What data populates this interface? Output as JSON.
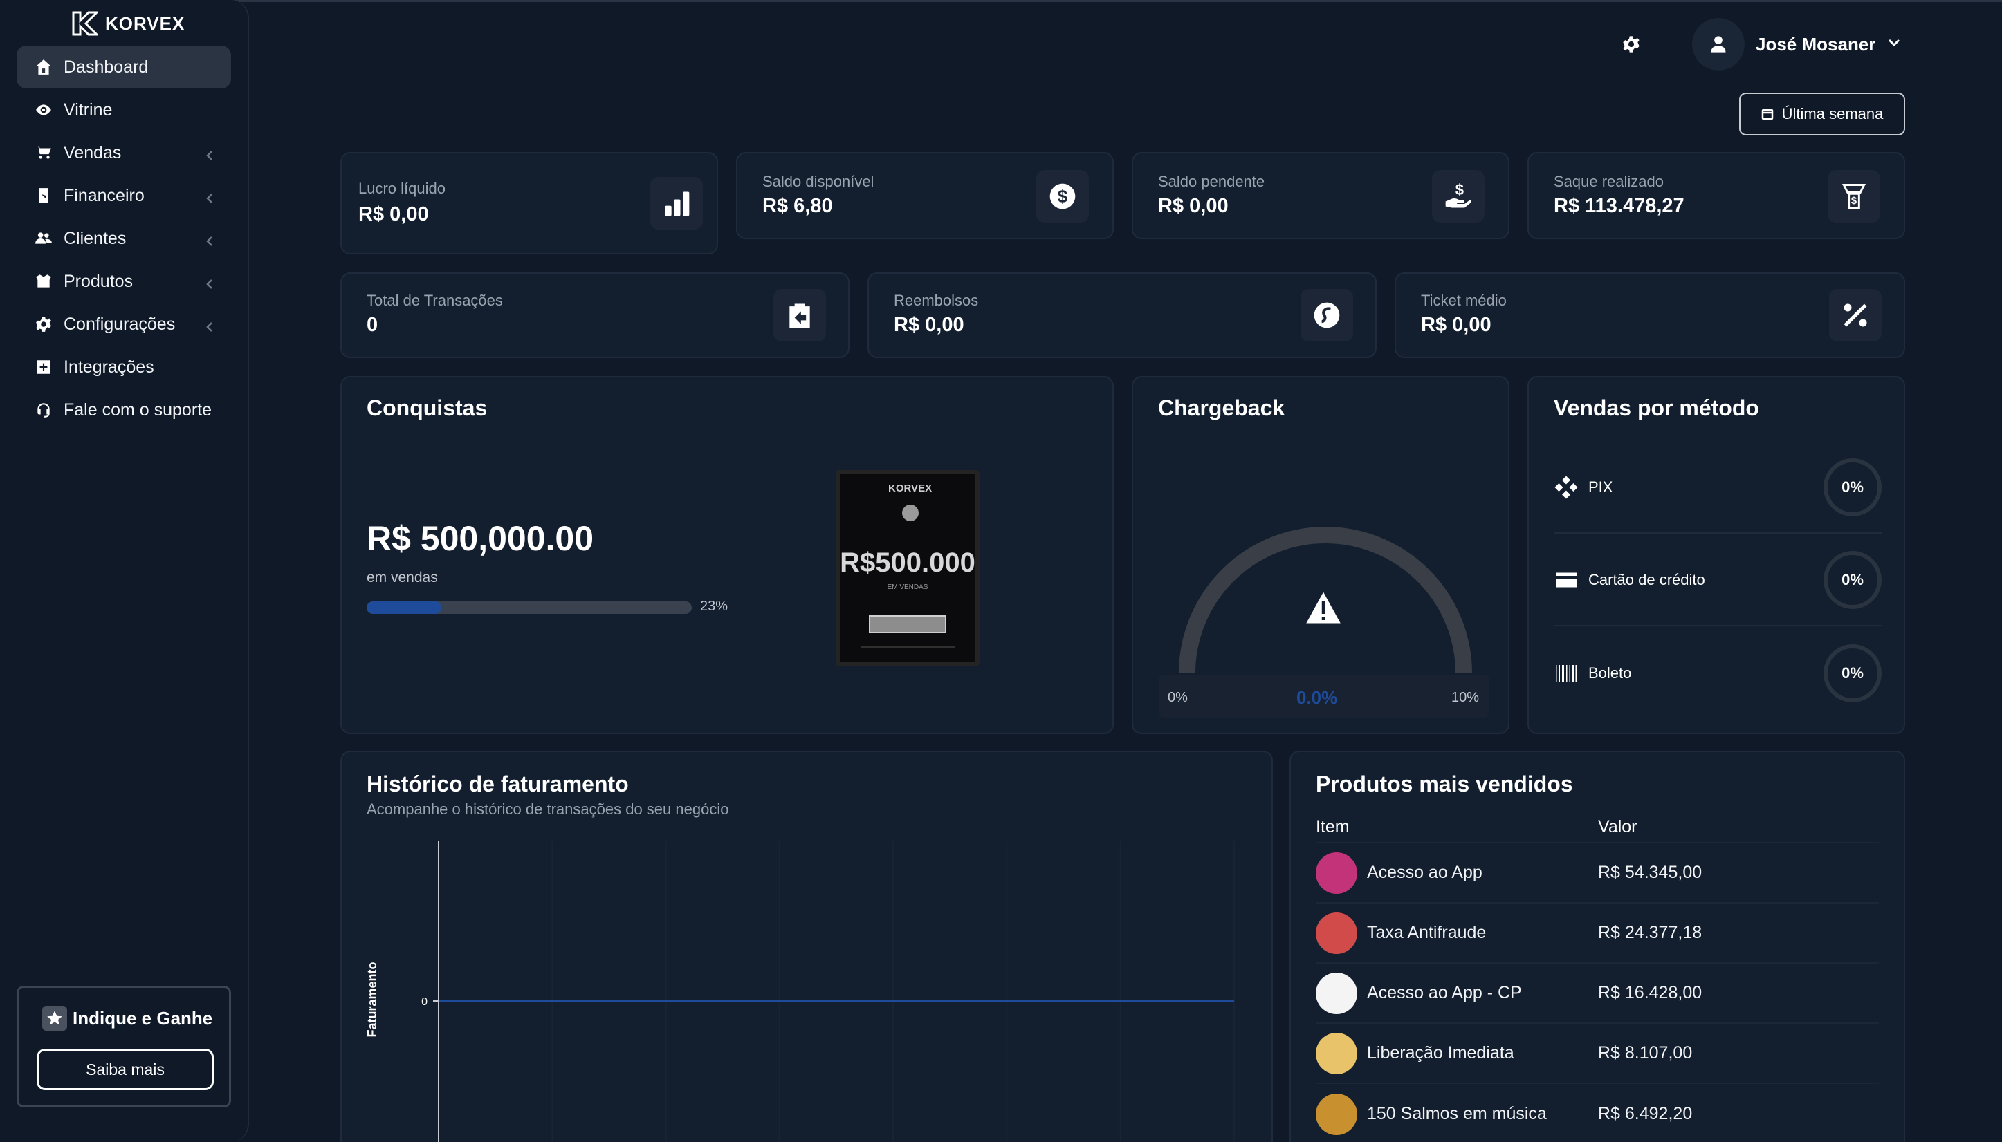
{
  "brand": {
    "name": "KORVEX"
  },
  "sidebar": {
    "items": [
      {
        "label": "Dashboard",
        "icon": "home-icon",
        "active": true,
        "has_submenu": false
      },
      {
        "label": "Vitrine",
        "icon": "eye-icon",
        "active": false,
        "has_submenu": false
      },
      {
        "label": "Vendas",
        "icon": "cart-icon",
        "active": false,
        "has_submenu": true
      },
      {
        "label": "Financeiro",
        "icon": "wallet-icon",
        "active": false,
        "has_submenu": true
      },
      {
        "label": "Clientes",
        "icon": "users-icon",
        "active": false,
        "has_submenu": true
      },
      {
        "label": "Produtos",
        "icon": "box-icon",
        "active": false,
        "has_submenu": true
      },
      {
        "label": "Configurações",
        "icon": "gear-icon",
        "active": false,
        "has_submenu": true
      },
      {
        "label": "Integrações",
        "icon": "plus-square-icon",
        "active": false,
        "has_submenu": false
      },
      {
        "label": "Fale com o suporte",
        "icon": "headset-icon",
        "active": false,
        "has_submenu": false
      }
    ],
    "refer": {
      "title": "Indique e Ganhe",
      "button": "Saiba mais"
    }
  },
  "header": {
    "user_name": "José Mosaner",
    "period_button": "Última semana"
  },
  "stats_row1": [
    {
      "label": "Lucro líquido",
      "value": "R$ 0,00",
      "icon": "bar-chart-icon"
    },
    {
      "label": "Saldo disponível",
      "value": "R$ 6,80",
      "icon": "dollar-circle-icon"
    },
    {
      "label": "Saldo pendente",
      "value": "R$ 0,00",
      "icon": "hand-dollar-icon"
    },
    {
      "label": "Saque realizado",
      "value": "R$ 113.478,27",
      "icon": "money-stack-icon"
    }
  ],
  "stats_row2": [
    {
      "label": "Total de Transações",
      "value": "0",
      "icon": "clipboard-arrow-icon"
    },
    {
      "label": "Reembolsos",
      "value": "R$ 0,00",
      "icon": "refund-icon"
    },
    {
      "label": "Ticket médio",
      "value": "R$ 0,00",
      "icon": "percent-icon"
    }
  ],
  "achievements": {
    "title": "Conquistas",
    "goal": "R$ 500,000.00",
    "subtitle": "em vendas",
    "progress_pct": 23,
    "progress_label": "23%",
    "plaque": {
      "brand": "KORVEX",
      "amount": "R$500.000",
      "sub": "EM VENDAS"
    }
  },
  "chargeback": {
    "title": "Chargeback",
    "min_label": "0%",
    "value_label": "0.0%",
    "max_label": "10%",
    "value_fraction": 0
  },
  "methods": {
    "title": "Vendas por método",
    "items": [
      {
        "label": "PIX",
        "pct": "0%",
        "icon": "pix-icon"
      },
      {
        "label": "Cartão de crédito",
        "pct": "0%",
        "icon": "credit-card-icon"
      },
      {
        "label": "Boleto",
        "pct": "0%",
        "icon": "barcode-icon"
      }
    ]
  },
  "history": {
    "title": "Histórico de faturamento",
    "subtitle": "Acompanhe o histórico de transações do seu negócio"
  },
  "chart_data": {
    "type": "line",
    "title": "",
    "xlabel": "",
    "ylabel": "Faturamento",
    "y_ticks": [
      "0"
    ],
    "series": [
      {
        "name": "",
        "values": [
          0,
          0,
          0,
          0,
          0,
          0,
          0
        ]
      }
    ],
    "grid": true
  },
  "products": {
    "title": "Produtos mais vendidos",
    "col_item": "Item",
    "col_value": "Valor",
    "rows": [
      {
        "name": "Acesso ao App",
        "value": "R$ 54.345,00",
        "thumb_color": "#c2337a"
      },
      {
        "name": "Taxa Antifraude",
        "value": "R$ 24.377,18",
        "thumb_color": "#d24b4b"
      },
      {
        "name": "Acesso ao App - CP",
        "value": "R$ 16.428,00",
        "thumb_color": "#f4f4f4"
      },
      {
        "name": "Liberação Imediata",
        "value": "R$ 8.107,00",
        "thumb_color": "#e8c36a"
      },
      {
        "name": "150 Salmos em música",
        "value": "R$ 6.492,20",
        "thumb_color": "#c9902f"
      }
    ]
  },
  "colors": {
    "background": "#0f1927",
    "card": "#131f2e",
    "accent": "#1e4b9a"
  }
}
